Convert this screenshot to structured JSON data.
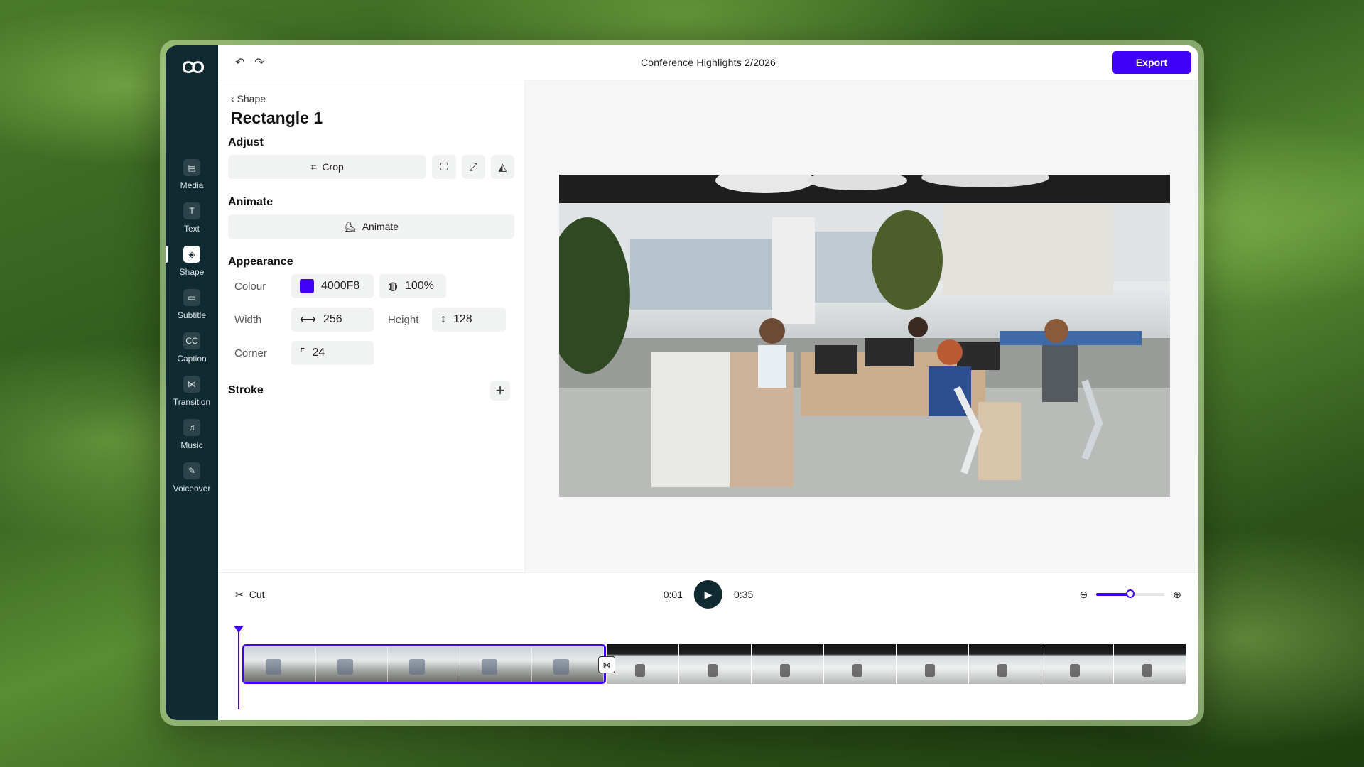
{
  "app": {
    "logo": "CO",
    "title": "Conference Highlights 2/2026",
    "export_label": "Export"
  },
  "rail": {
    "items": [
      {
        "label": "Media",
        "icon": "media-icon",
        "glyph": "▤"
      },
      {
        "label": "Text",
        "icon": "text-icon",
        "glyph": "T"
      },
      {
        "label": "Shape",
        "icon": "shape-icon",
        "glyph": "◈",
        "active": true
      },
      {
        "label": "Subtitle",
        "icon": "subtitle-icon",
        "glyph": "▭"
      },
      {
        "label": "Caption",
        "icon": "caption-icon",
        "glyph": "CC"
      },
      {
        "label": "Transition",
        "icon": "transition-icon",
        "glyph": "⋈"
      },
      {
        "label": "Music",
        "icon": "music-icon",
        "glyph": "♫"
      },
      {
        "label": "Voiceover",
        "icon": "mic-icon",
        "glyph": "✎"
      }
    ]
  },
  "panel": {
    "breadcrumb": "Shape",
    "heading": "Rectangle 1",
    "adjust": {
      "title": "Adjust",
      "crop_label": "Crop"
    },
    "animate": {
      "title": "Animate",
      "button_label": "Animate"
    },
    "appearance": {
      "title": "Appearance",
      "colour_label": "Colour",
      "colour_value": "4000F8",
      "colour_hex": "#4000F8",
      "opacity_value": "100%",
      "width_label": "Width",
      "width_value": "256",
      "height_label": "Height",
      "height_value": "128",
      "corner_label": "Corner",
      "corner_value": "24"
    },
    "stroke": {
      "title": "Stroke"
    }
  },
  "timeline": {
    "cut_label": "Cut",
    "current_time": "0:01",
    "total_time": "0:35",
    "zoom_level": 0.5
  },
  "colors": {
    "accent": "#4000f8",
    "rail_bg": "#0f2a30"
  }
}
